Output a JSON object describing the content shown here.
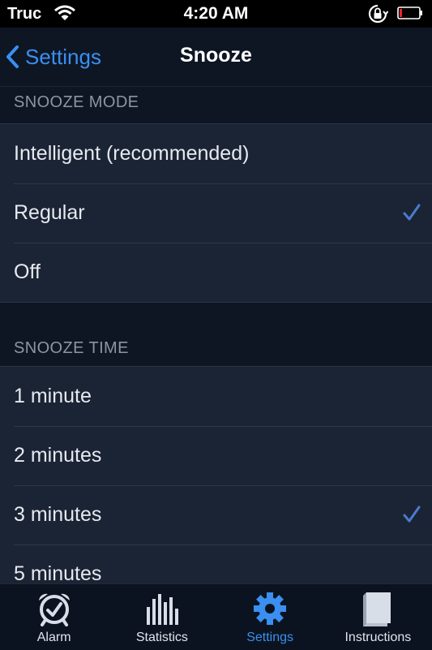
{
  "status_bar": {
    "carrier": "Truc",
    "time": "4:20 AM"
  },
  "nav": {
    "back_label": "Settings",
    "title": "Snooze"
  },
  "snooze_mode": {
    "header": "SNOOZE MODE",
    "options": [
      {
        "label": "Intelligent (recommended)",
        "selected": false
      },
      {
        "label": "Regular",
        "selected": true
      },
      {
        "label": "Off",
        "selected": false
      }
    ]
  },
  "snooze_time": {
    "header": "SNOOZE TIME",
    "options": [
      {
        "label": "1 minute",
        "selected": false
      },
      {
        "label": "2 minutes",
        "selected": false
      },
      {
        "label": "3 minutes",
        "selected": true
      },
      {
        "label": "5 minutes",
        "selected": false
      }
    ]
  },
  "tabs": [
    {
      "label": "Alarm",
      "icon": "alarm-clock-icon",
      "active": false
    },
    {
      "label": "Statistics",
      "icon": "bar-chart-icon",
      "active": false
    },
    {
      "label": "Settings",
      "icon": "gear-icon",
      "active": true
    },
    {
      "label": "Instructions",
      "icon": "book-icon",
      "active": false
    }
  ],
  "colors": {
    "accent": "#3a8ff0",
    "check": "#4a7bd0",
    "background": "#0e1624",
    "cell": "#1b2434"
  }
}
